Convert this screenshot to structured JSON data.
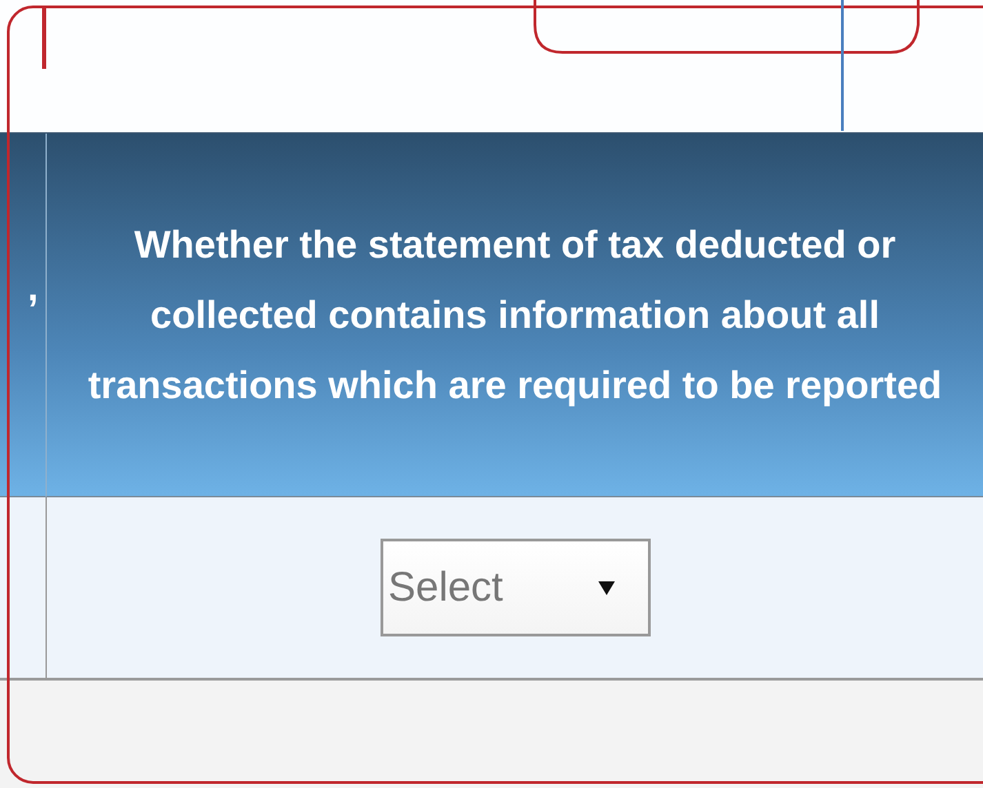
{
  "table": {
    "columns": [
      {
        "header": ","
      },
      {
        "header": "Whether the statement of tax deducted or collected contains information about all transactions which are required to be reported"
      }
    ],
    "rows": [
      {
        "cells": [
          {
            "kind": "empty"
          },
          {
            "kind": "select",
            "value": "Select"
          }
        ]
      }
    ]
  }
}
